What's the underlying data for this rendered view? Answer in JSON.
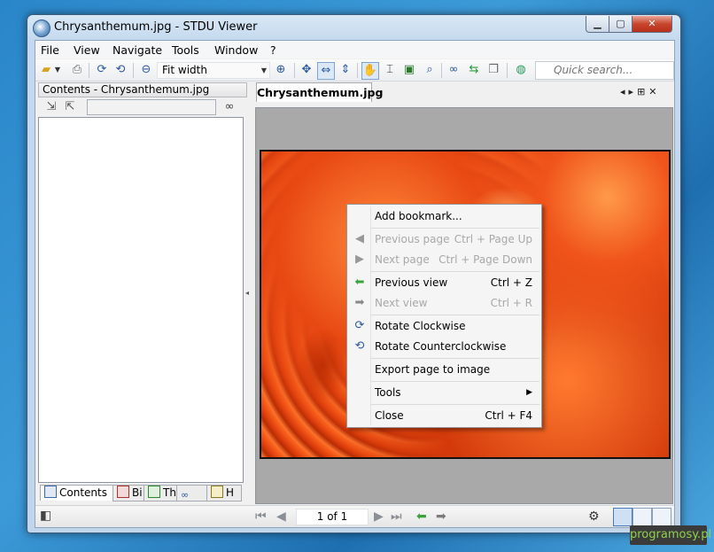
{
  "window": {
    "title": "Chrysanthemum.jpg - STDU Viewer"
  },
  "menu": [
    "File",
    "View",
    "Navigate",
    "Tools",
    "Window",
    "?"
  ],
  "toolbar": {
    "zoom_value": "Fit width",
    "quick_search_placeholder": "Quick search..."
  },
  "left_panel": {
    "header": "Contents - Chrysanthemum.jpg",
    "tabs": [
      "Contents",
      "Bi",
      "Th",
      "",
      "H"
    ]
  },
  "document": {
    "tab_label": "Chrysanthemum.jpg"
  },
  "status": {
    "page_indicator": "1 of 1"
  },
  "context_menu": [
    {
      "label": "Add bookmark...",
      "shortcut": "",
      "enabled": true,
      "icon": ""
    },
    {
      "label": "Previous page",
      "shortcut": "Ctrl + Page Up",
      "enabled": false,
      "icon": "prev-page-icon"
    },
    {
      "label": "Next page",
      "shortcut": "Ctrl + Page Down",
      "enabled": false,
      "icon": "next-page-icon"
    },
    {
      "label": "Previous view",
      "shortcut": "Ctrl + Z",
      "enabled": true,
      "icon": "prev-view-icon"
    },
    {
      "label": "Next view",
      "shortcut": "Ctrl + R",
      "enabled": false,
      "icon": "next-view-icon"
    },
    {
      "label": "Rotate Clockwise",
      "shortcut": "",
      "enabled": true,
      "icon": "rotate-cw-icon"
    },
    {
      "label": "Rotate Counterclockwise",
      "shortcut": "",
      "enabled": true,
      "icon": "rotate-ccw-icon"
    },
    {
      "label": "Export page to image",
      "shortcut": "",
      "enabled": true,
      "icon": ""
    },
    {
      "label": "Tools",
      "shortcut": "",
      "enabled": true,
      "icon": ""
    },
    {
      "label": "Close",
      "shortcut": "Ctrl + F4",
      "enabled": true,
      "icon": ""
    }
  ],
  "watermark": "programosy.pl",
  "colors": {
    "accent": "#3a6aa5",
    "enabled_arrow": "#3aa43a",
    "disabled": "#a8a8a8"
  }
}
